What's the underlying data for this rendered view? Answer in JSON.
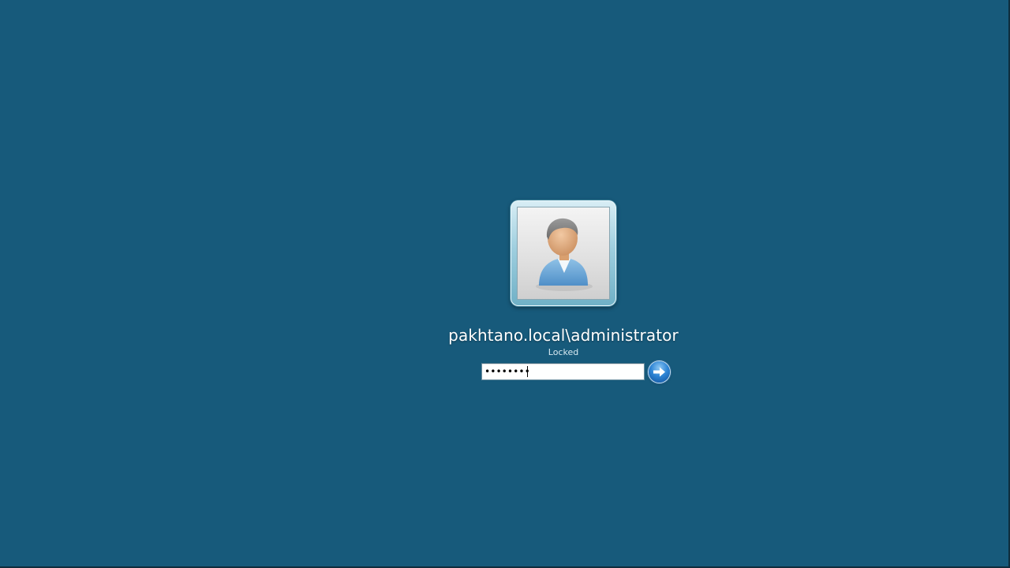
{
  "background_color": "#175a7b",
  "login": {
    "avatar_icon": "user-avatar-icon",
    "username": "pakhtano.local\\administrator",
    "status": "Locked",
    "password_value": "••••••••",
    "submit_icon": "arrow-right-icon"
  }
}
